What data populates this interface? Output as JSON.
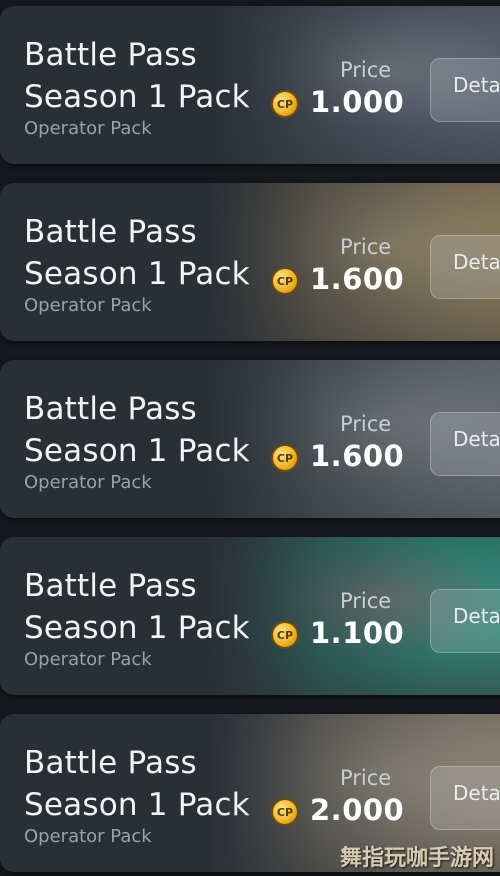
{
  "cards": [
    {
      "title_line1": "Battle Pass",
      "title_line2": "Season 1 Pack",
      "subtitle": "Operator Pack",
      "price_label": "Price",
      "currency_icon": "cp-coin-icon",
      "currency_abbr": "CP",
      "price": "1.000",
      "details_label": "Deta",
      "art_colors": [
        "#5a6070",
        "#8a8f9a",
        "#3d434d"
      ]
    },
    {
      "title_line1": "Battle Pass",
      "title_line2": "Season 1 Pack",
      "subtitle": "Operator Pack",
      "price_label": "Price",
      "currency_icon": "cp-coin-icon",
      "currency_abbr": "CP",
      "price": "1.600",
      "details_label": "Deta",
      "art_colors": [
        "#8c7d5e",
        "#b3a27a",
        "#5d5443"
      ]
    },
    {
      "title_line1": "Battle Pass",
      "title_line2": "Season 1 Pack",
      "subtitle": "Operator Pack",
      "price_label": "Price",
      "currency_icon": "cp-coin-icon",
      "currency_abbr": "CP",
      "price": "1.600",
      "details_label": "Deta",
      "art_colors": [
        "#6b6f76",
        "#8e9298",
        "#4a4e55"
      ]
    },
    {
      "title_line1": "Battle Pass",
      "title_line2": "Season 1 Pack",
      "subtitle": "Operator Pack",
      "price_label": "Price",
      "currency_icon": "cp-coin-icon",
      "currency_abbr": "CP",
      "price": "1.100",
      "details_label": "Deta",
      "art_colors": [
        "#2f8a7a",
        "#7e8c84",
        "#3c4a46"
      ]
    },
    {
      "title_line1": "Battle Pass",
      "title_line2": "Season 1 Pack",
      "subtitle": "Operator Pack",
      "price_label": "Price",
      "currency_icon": "cp-coin-icon",
      "currency_abbr": "CP",
      "price": "2.000",
      "details_label": "Deta",
      "art_colors": [
        "#8f8676",
        "#b0a690",
        "#5e574b"
      ]
    }
  ],
  "watermark": "舞指玩咖手游网"
}
